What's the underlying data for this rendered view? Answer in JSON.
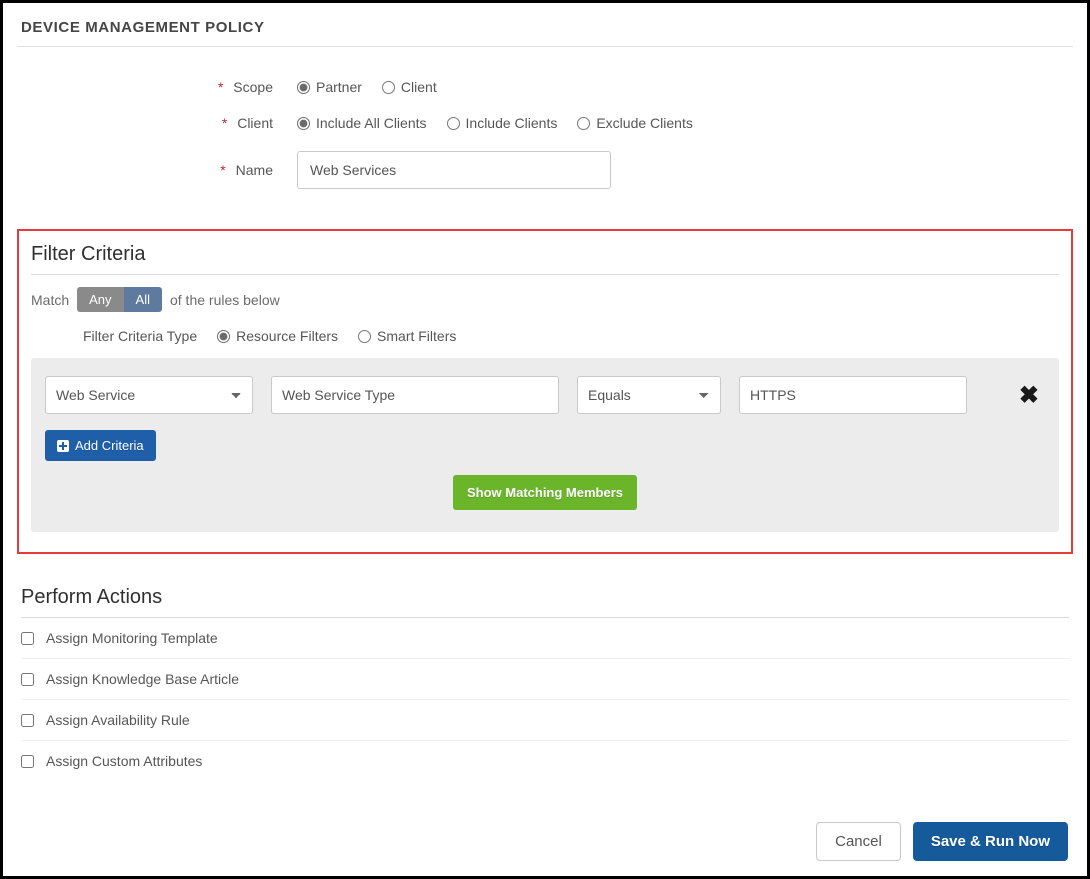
{
  "title": "DEVICE MANAGEMENT POLICY",
  "form": {
    "scope": {
      "label": "Scope",
      "partner": "Partner",
      "client": "Client",
      "selected": "Partner"
    },
    "client": {
      "label": "Client",
      "include_all": "Include All Clients",
      "include": "Include Clients",
      "exclude": "Exclude Clients",
      "selected": "Include All Clients"
    },
    "name": {
      "label": "Name",
      "value": "Web Services"
    }
  },
  "filter": {
    "heading": "Filter Criteria",
    "match_prefix": "Match",
    "match_any": "Any",
    "match_all": "All",
    "match_suffix": "of the rules below",
    "type_label": "Filter Criteria Type",
    "type_resource": "Resource Filters",
    "type_smart": "Smart Filters",
    "criteria": [
      {
        "field": "Web Service",
        "attribute": "Web Service Type",
        "operator": "Equals",
        "value": "HTTPS"
      }
    ],
    "add_label": "Add Criteria",
    "show_label": "Show Matching Members"
  },
  "actions": {
    "heading": "Perform Actions",
    "items": [
      "Assign Monitoring Template",
      "Assign Knowledge Base Article",
      "Assign Availability Rule",
      "Assign Custom Attributes"
    ]
  },
  "footer": {
    "cancel": "Cancel",
    "save": "Save & Run Now"
  }
}
